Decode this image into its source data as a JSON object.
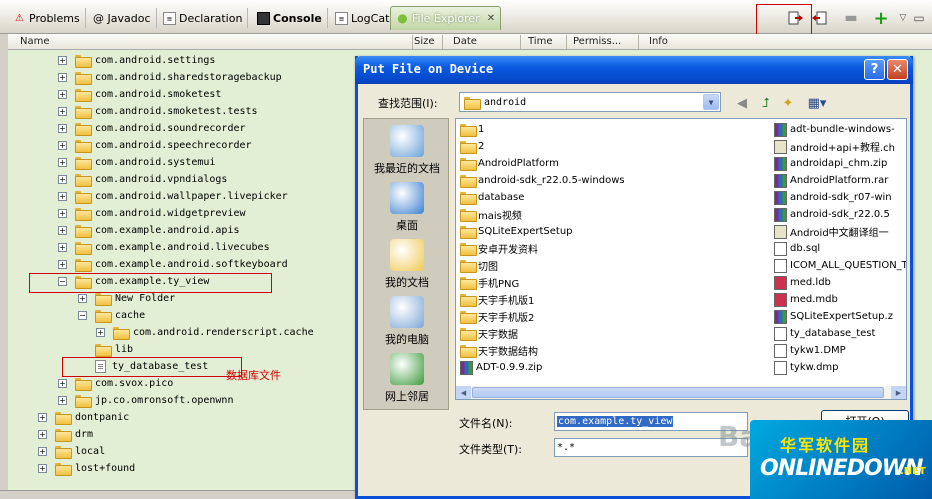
{
  "tabs": [
    {
      "label": "Problems",
      "icon": "problems-icon"
    },
    {
      "label": "@ Javadoc",
      "icon": "javadoc-icon"
    },
    {
      "label": "Declaration",
      "icon": "declaration-icon"
    },
    {
      "label": "Console",
      "icon": "console-icon"
    },
    {
      "label": "LogCat",
      "icon": "logcat-icon"
    },
    {
      "label": "File Explorer",
      "icon": "android-icon"
    }
  ],
  "columns": [
    "Name",
    "Size",
    "Date",
    "Time",
    "Permiss...",
    "Info"
  ],
  "tree": [
    {
      "label": "com.android.settings",
      "depth": 2,
      "type": "folder",
      "expander": "+"
    },
    {
      "label": "com.android.sharedstoragebackup",
      "depth": 2,
      "type": "folder",
      "expander": "+"
    },
    {
      "label": "com.android.smoketest",
      "depth": 2,
      "type": "folder",
      "expander": "+"
    },
    {
      "label": "com.android.smoketest.tests",
      "depth": 2,
      "type": "folder",
      "expander": "+"
    },
    {
      "label": "com.android.soundrecorder",
      "depth": 2,
      "type": "folder",
      "expander": "+"
    },
    {
      "label": "com.android.speechrecorder",
      "depth": 2,
      "type": "folder",
      "expander": "+"
    },
    {
      "label": "com.android.systemui",
      "depth": 2,
      "type": "folder",
      "expander": "+"
    },
    {
      "label": "com.android.vpndialogs",
      "depth": 2,
      "type": "folder",
      "expander": "+"
    },
    {
      "label": "com.android.wallpaper.livepicker",
      "depth": 2,
      "type": "folder",
      "expander": "+"
    },
    {
      "label": "com.android.widgetpreview",
      "depth": 2,
      "type": "folder",
      "expander": "+"
    },
    {
      "label": "com.example.android.apis",
      "depth": 2,
      "type": "folder",
      "expander": "+"
    },
    {
      "label": "com.example.android.livecubes",
      "depth": 2,
      "type": "folder",
      "expander": "+"
    },
    {
      "label": "com.example.android.softkeyboard",
      "depth": 2,
      "type": "folder",
      "expander": "+"
    },
    {
      "label": "com.example.ty_view",
      "depth": 2,
      "type": "folder",
      "expander": "−"
    },
    {
      "label": "New Folder",
      "depth": 3,
      "type": "folder",
      "expander": "+"
    },
    {
      "label": "cache",
      "depth": 3,
      "type": "folder",
      "expander": "−"
    },
    {
      "label": "com.android.renderscript.cache",
      "depth": 4,
      "type": "folder",
      "expander": "+"
    },
    {
      "label": "lib",
      "depth": 3,
      "type": "folder",
      "expander": ""
    },
    {
      "label": "ty_database_test",
      "depth": 3,
      "type": "file",
      "expander": ""
    },
    {
      "label": "com.svox.pico",
      "depth": 2,
      "type": "folder",
      "expander": "+"
    },
    {
      "label": "jp.co.omronsoft.openwnn",
      "depth": 2,
      "type": "folder",
      "expander": "+"
    },
    {
      "label": "dontpanic",
      "depth": 1,
      "type": "folder",
      "expander": "+"
    },
    {
      "label": "drm",
      "depth": 1,
      "type": "folder",
      "expander": "+"
    },
    {
      "label": "local",
      "depth": 1,
      "type": "folder",
      "expander": "+"
    },
    {
      "label": "lost+found",
      "depth": 1,
      "type": "folder",
      "expander": "+"
    }
  ],
  "annotation": "数据库文件",
  "dialog": {
    "title": "Put File on Device",
    "help_label": "?",
    "close_label": "✕",
    "look_in_label": "查找范围(I):",
    "look_in_value": "android",
    "places": [
      {
        "label": "我最近的文档",
        "icon": "recent-documents-icon",
        "color": "#6aa0d8"
      },
      {
        "label": "桌面",
        "icon": "desktop-icon",
        "color": "#3a7fd0"
      },
      {
        "label": "我的文档",
        "icon": "my-documents-icon",
        "color": "#f0c850"
      },
      {
        "label": "我的电脑",
        "icon": "my-computer-icon",
        "color": "#7ea6d6"
      },
      {
        "label": "网上邻居",
        "icon": "network-places-icon",
        "color": "#3a9a3a"
      }
    ],
    "files_col1": [
      {
        "name": "1",
        "type": "folder"
      },
      {
        "name": "2",
        "type": "folder"
      },
      {
        "name": "AndroidPlatform",
        "type": "folder"
      },
      {
        "name": "android-sdk_r22.0.5-windows",
        "type": "folder"
      },
      {
        "name": "database",
        "type": "folder"
      },
      {
        "name": "mais视频",
        "type": "folder"
      },
      {
        "name": "SQLiteExpertSetup",
        "type": "folder"
      },
      {
        "name": "安卓开发资料",
        "type": "folder"
      },
      {
        "name": "切图",
        "type": "folder"
      },
      {
        "name": "手机PNG",
        "type": "folder"
      },
      {
        "name": "天宇手机版1",
        "type": "folder"
      },
      {
        "name": "天宇手机版2",
        "type": "folder"
      },
      {
        "name": "天宇数据",
        "type": "folder"
      },
      {
        "name": "天宇数据结构",
        "type": "folder"
      },
      {
        "name": "ADT-0.9.9.zip",
        "type": "zip"
      }
    ],
    "files_col2": [
      {
        "name": "adt-bundle-windows-",
        "type": "rar"
      },
      {
        "name": "android+api+教程.ch",
        "type": "chm"
      },
      {
        "name": "androidapi_chm.zip",
        "type": "zip"
      },
      {
        "name": "AndroidPlatform.rar",
        "type": "rar"
      },
      {
        "name": "android-sdk_r07-win",
        "type": "rar"
      },
      {
        "name": "android-sdk_r22.0.5",
        "type": "rar"
      },
      {
        "name": "Android中文翻译组一",
        "type": "chm"
      },
      {
        "name": "db.sql",
        "type": "sql"
      },
      {
        "name": "ICOM_ALL_QUESTION_T",
        "type": "txt"
      },
      {
        "name": "med.ldb",
        "type": "mdb"
      },
      {
        "name": "med.mdb",
        "type": "mdb"
      },
      {
        "name": "SQLiteExpertSetup.z",
        "type": "zip"
      },
      {
        "name": "ty_database_test",
        "type": "txt"
      },
      {
        "name": "tykw1.DMP",
        "type": "txt"
      },
      {
        "name": "tykw.dmp",
        "type": "txt"
      }
    ],
    "filename_label": "文件名(N):",
    "filename_value": "com.example.ty_view",
    "filetype_label": "文件类型(T):",
    "filetype_value": "*.*",
    "open_label": "打开(O)"
  },
  "watermark": {
    "cn": "华军软件园",
    "en": "ONLINEDOWN",
    "com": ".NET",
    "baidu": "Ba"
  },
  "colors": {
    "tree_bg": "#e3efd5",
    "titlebar": "#0a5ae0",
    "highlight": "#d00000"
  }
}
